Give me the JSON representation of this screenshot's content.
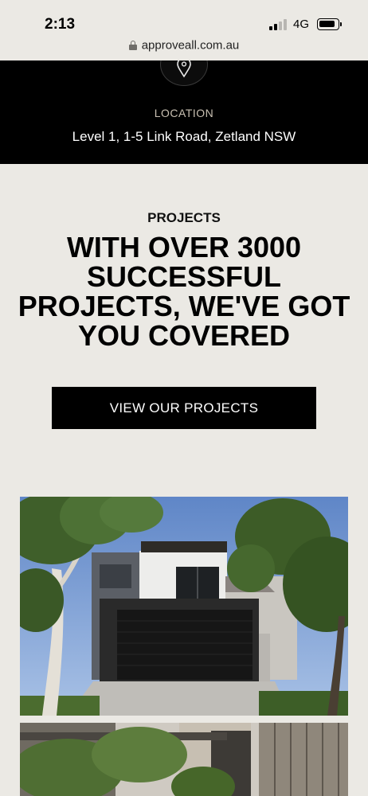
{
  "status_bar": {
    "time": "2:13",
    "network": "4G",
    "signal_bars_active": 2,
    "signal_bars_total": 4
  },
  "browser": {
    "url": "approveall.com.au"
  },
  "location": {
    "label": "LOCATION",
    "address": "Level 1, 1-5 Link Road, Zetland NSW"
  },
  "projects": {
    "label": "PROJECTS",
    "heading": "WITH OVER 3000 SUCCESSFUL PROJECTS, WE'VE GOT YOU COVERED",
    "button_label": "VIEW OUR PROJECTS"
  },
  "colors": {
    "page_bg": "#ebe9e4",
    "band_bg": "#000000",
    "button_bg": "#000000",
    "label_accent": "#c9c0b2"
  }
}
